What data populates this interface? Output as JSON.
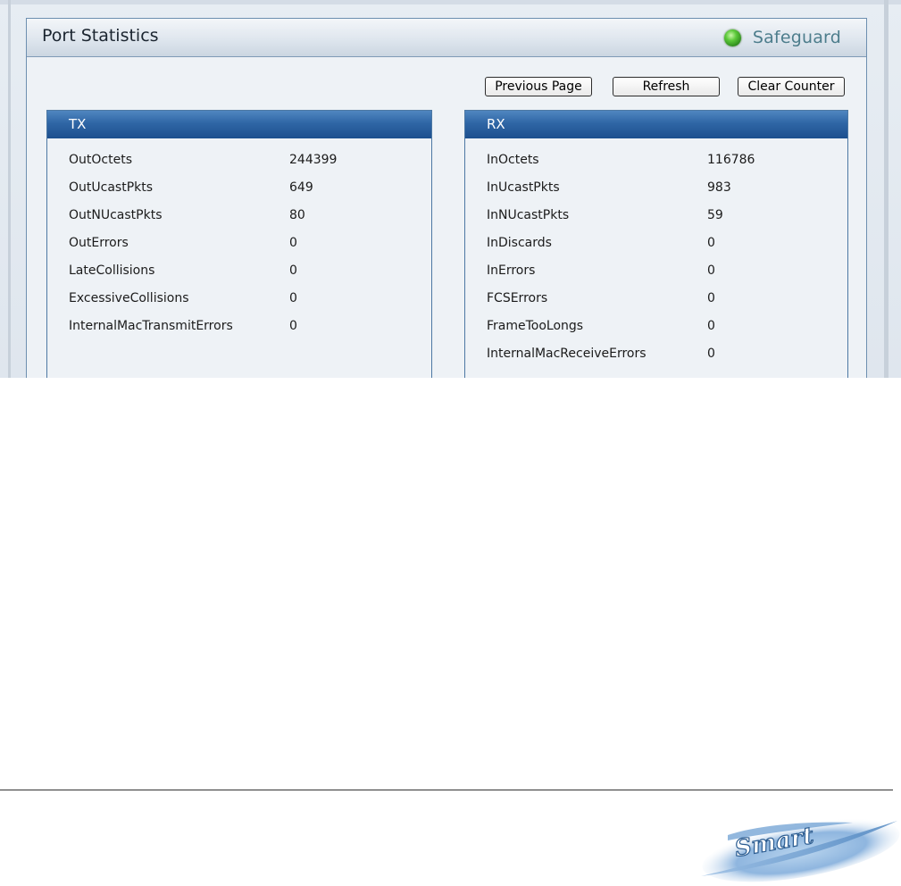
{
  "panel": {
    "title": "Port Statistics",
    "status_label": "Safeguard",
    "status_color": "#4cbb2e"
  },
  "toolbar": {
    "previous_label": "Previous Page",
    "refresh_label": "Refresh",
    "clear_label": "Clear Counter"
  },
  "tx": {
    "heading": "TX",
    "rows": [
      {
        "label": "OutOctets",
        "value": "244399"
      },
      {
        "label": "OutUcastPkts",
        "value": "649"
      },
      {
        "label": "OutNUcastPkts",
        "value": "80"
      },
      {
        "label": "OutErrors",
        "value": "0"
      },
      {
        "label": "LateCollisions",
        "value": "0"
      },
      {
        "label": "ExcessiveCollisions",
        "value": "0"
      },
      {
        "label": "InternalMacTransmitErrors",
        "value": "0"
      }
    ]
  },
  "rx": {
    "heading": "RX",
    "rows": [
      {
        "label": "InOctets",
        "value": "116786"
      },
      {
        "label": "InUcastPkts",
        "value": "983"
      },
      {
        "label": "InNUcastPkts",
        "value": "59"
      },
      {
        "label": "InDiscards",
        "value": "0"
      },
      {
        "label": "InErrors",
        "value": "0"
      },
      {
        "label": "FCSErrors",
        "value": "0"
      },
      {
        "label": "FrameTooLongs",
        "value": "0"
      },
      {
        "label": "InternalMacReceiveErrors",
        "value": "0"
      }
    ]
  },
  "footer": {
    "logo_text": "Smart"
  }
}
